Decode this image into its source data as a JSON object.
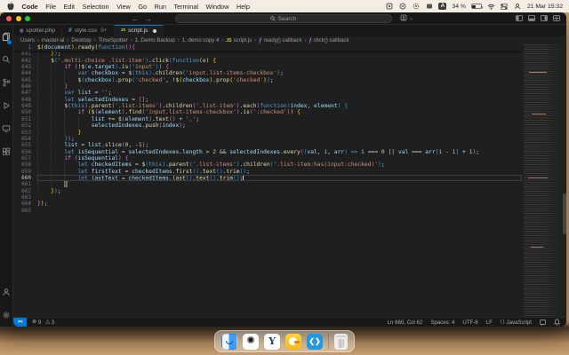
{
  "colors": {
    "accent_blue": "#0078d4",
    "editor_bg": "#1f1f1f",
    "titlebar_bg": "#181818",
    "error_red": "#f14c4c",
    "string_orange": "#ce9178",
    "keyword_blue": "#569cd6"
  },
  "menu_bar": {
    "app_name": "Code",
    "items": [
      "File",
      "Edit",
      "Selection",
      "View",
      "Go",
      "Run",
      "Terminal",
      "Window",
      "Help"
    ],
    "status_icons": [
      "menu-extra-1",
      "menu-extra-2",
      "menu-extra-3",
      "menu-extra-4",
      "input-source-a",
      "battery",
      "wifi",
      "control-center",
      "fast-user-switch"
    ],
    "battery": "34 %",
    "clock": "21 Mar 15:32"
  },
  "title_bar": {
    "search_placeholder": "Search",
    "back_arrow": "←",
    "forward_arrow": "→"
  },
  "activity_bar": {
    "icons": [
      "explorer",
      "search",
      "source-control",
      "run-and-debug",
      "remote-explorer",
      "extensions",
      "accounts",
      "settings"
    ]
  },
  "tabs": [
    {
      "label": "spotter.php",
      "icon": "php",
      "active": false,
      "modified": false
    },
    {
      "label": "style.css",
      "badge": "9+",
      "icon": "css",
      "active": false,
      "modified": false
    },
    {
      "label": "script.js",
      "icon": "js",
      "active": true,
      "modified": true
    }
  ],
  "breadcrumbs": [
    {
      "label": "Users"
    },
    {
      "label": "master-al"
    },
    {
      "label": "Desktop"
    },
    {
      "label": "TimeSpotter"
    },
    {
      "label": "1. Demo Backup"
    },
    {
      "label": "1. demo copy 4"
    },
    {
      "label": "script.js",
      "icon": "js"
    },
    {
      "label": "ready() callback",
      "icon": "symbol-method"
    },
    {
      "label": "click() callback",
      "icon": "symbol-method"
    }
  ],
  "editor": {
    "sticky_line": {
      "num": 1,
      "text": "$(document).ready(function(){"
    },
    "current_line": 660,
    "bracket_match_line": 661,
    "lines": [
      {
        "num": 641,
        "text": "    });"
      },
      {
        "num": 642,
        "text": "    $('.multi-choice .list-item').click(function(e) {"
      },
      {
        "num": 643,
        "text": "        if (!$(e.target).is('input')) {"
      },
      {
        "num": 644,
        "text": "            var checkbox = $(this).children('input.list-items-checkbox');"
      },
      {
        "num": 645,
        "text": "            $(checkbox).prop('checked', !$(checkbox).prop('checked'));"
      },
      {
        "num": 646,
        "text": "        }"
      },
      {
        "num": 647,
        "text": "        var list = '';"
      },
      {
        "num": 648,
        "text": "        let selectedIndexes = [];"
      },
      {
        "num": 649,
        "text": "        $(this).parent('.list-items').children('.list-item').each(function(index, element) {"
      },
      {
        "num": 650,
        "text": "            if ($(element).find('input.list-items-checkbox').is(':checked')) {"
      },
      {
        "num": 651,
        "text": "                list += $(element).text() + ',';"
      },
      {
        "num": 652,
        "text": "                selectedIndexes.push(index);"
      },
      {
        "num": 653,
        "text": "            }"
      },
      {
        "num": 654,
        "text": "        });"
      },
      {
        "num": 655,
        "text": "        list = list.slice(0, -1);"
      },
      {
        "num": 656,
        "text": "        let isSequential = selectedIndexes.length > 2 && selectedIndexes.every((val, i, arr) => i === 0 || val === arr[i - 1] + 1);"
      },
      {
        "num": 657,
        "text": "        if (isSequential) {"
      },
      {
        "num": 658,
        "text": "            let checkedItems = $(this).parent('.list-items').children('.list-item:has(input:checked)');"
      },
      {
        "num": 659,
        "text": "            let firstText = checkedItems.first().text().trim();"
      },
      {
        "num": 660,
        "text": "            let lastText = checkedItems.last().text().trim();"
      },
      {
        "num": 661,
        "text": "        }"
      },
      {
        "num": 662,
        "text": "    });"
      },
      {
        "num": 663,
        "text": ""
      },
      {
        "num": 664,
        "text": "});"
      },
      {
        "num": 665,
        "text": ""
      }
    ]
  },
  "status_bar": {
    "errors": "9",
    "warnings": "3",
    "cursor": "Ln 660, Col 62",
    "indentation": "Spaces: 4",
    "encoding": "UTF-8",
    "eol": "LF",
    "language": "JavaScript",
    "language_icon": "{ }"
  },
  "dock": {
    "items": [
      "finder",
      "chatgpt",
      "y-browser",
      "duck-app",
      "vscode",
      "trash"
    ]
  }
}
